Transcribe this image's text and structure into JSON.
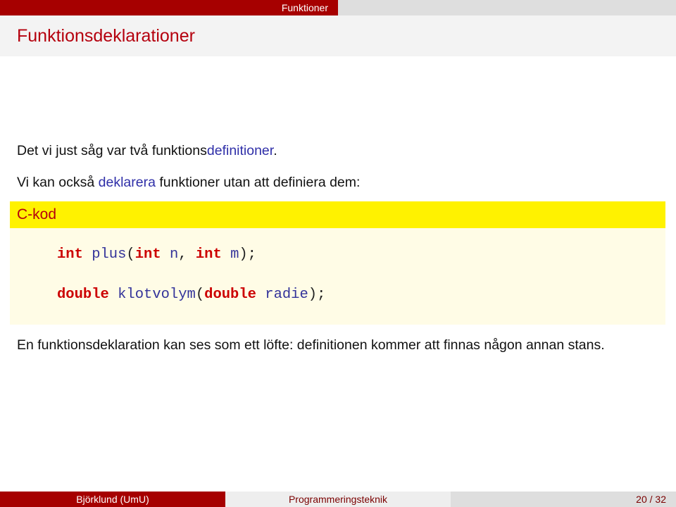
{
  "headline": {
    "section": "Funktioner"
  },
  "frame": {
    "title": "Funktionsdeklarationer"
  },
  "paragraphs": {
    "p1": {
      "before": "Det vi just såg var två funktions",
      "highlight": "definitioner",
      "after": "."
    },
    "p2": {
      "before": "Vi kan också ",
      "highlight": "deklarera",
      "after": " funktioner utan att definiera dem:"
    },
    "p3": {
      "text": "En funktionsdeklaration kan ses som ett löfte: definitionen kommer att finnas någon annan stans."
    }
  },
  "code_block": {
    "title": "C-kod",
    "lines": [
      {
        "tokens": [
          {
            "type": "kw",
            "text": "int"
          },
          {
            "type": "id",
            "text": " plus"
          },
          {
            "type": "punct",
            "text": "("
          },
          {
            "type": "kw",
            "text": "int"
          },
          {
            "type": "id",
            "text": " n"
          },
          {
            "type": "punct",
            "text": ", "
          },
          {
            "type": "kw",
            "text": "int"
          },
          {
            "type": "id",
            "text": " m"
          },
          {
            "type": "punct",
            "text": ");"
          }
        ]
      },
      {
        "tokens": [
          {
            "type": "kw",
            "text": "double"
          },
          {
            "type": "id",
            "text": " klotvolym"
          },
          {
            "type": "punct",
            "text": "("
          },
          {
            "type": "kw",
            "text": "double"
          },
          {
            "type": "id",
            "text": " radie"
          },
          {
            "type": "punct",
            "text": ");"
          }
        ]
      }
    ]
  },
  "footer": {
    "author": "Björklund  (UmU)",
    "course": "Programmeringsteknik",
    "page": "20 / 32"
  },
  "colors": {
    "theme_red": "#a60000",
    "title_red": "#b5000e",
    "highlight_blue": "#2f2fa8",
    "block_title_bg": "#fff200",
    "block_body_bg": "#fffce6",
    "keyword_red": "#cc0000",
    "identifier_blue": "#33339a"
  }
}
